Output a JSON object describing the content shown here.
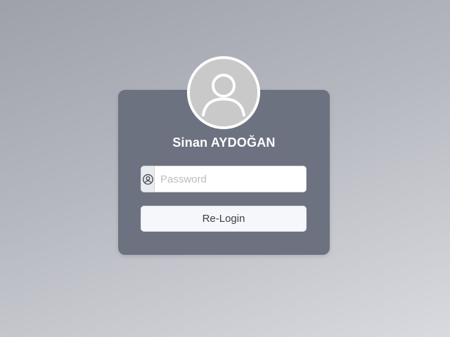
{
  "user": {
    "name": "Sinan AYDOĞAN",
    "avatar_icon": "user-avatar-icon"
  },
  "password": {
    "icon": "user-circle-icon",
    "placeholder": "Password",
    "value": ""
  },
  "actions": {
    "relogin_label": "Re-Login"
  },
  "colors": {
    "card": "#6c7280",
    "avatar_bg": "#c9c9ca",
    "button_bg": "#f5f7fa"
  }
}
